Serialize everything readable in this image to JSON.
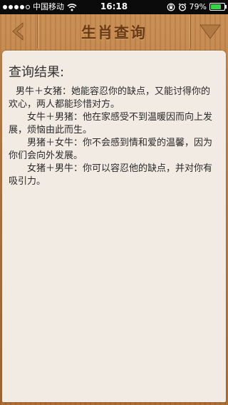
{
  "status_bar": {
    "carrier": "中国移动",
    "time": "16:18",
    "battery_percent": "79%",
    "battery_level": 0.79,
    "signal_icon": "signal-dots-icon",
    "wifi_icon": "wifi-icon",
    "lock_icon": "rotation-lock-icon",
    "alarm_icon": "alarm-icon",
    "battery_color": "#36d445"
  },
  "nav_bar": {
    "title": "生肖查询",
    "back_icon": "back-arrow-icon",
    "menu_icon": "dropdown-triangle-icon",
    "title_color": "#6a3a14"
  },
  "content": {
    "heading": "查询结果:",
    "paragraphs": [
      "男牛＋女猪：她能容忍你的缺点，又能讨得你的欢心，两人都能珍惜对方。",
      "女牛＋男猪：他在家感受不到温暖因而向上发展，烦恼由此而生。",
      "男猪＋女牛：你不会感到情和爱的温馨，因为你们会向外发展。",
      "女猪＋男牛：你可以容忍他的缺点，并对你有吸引力。"
    ]
  }
}
